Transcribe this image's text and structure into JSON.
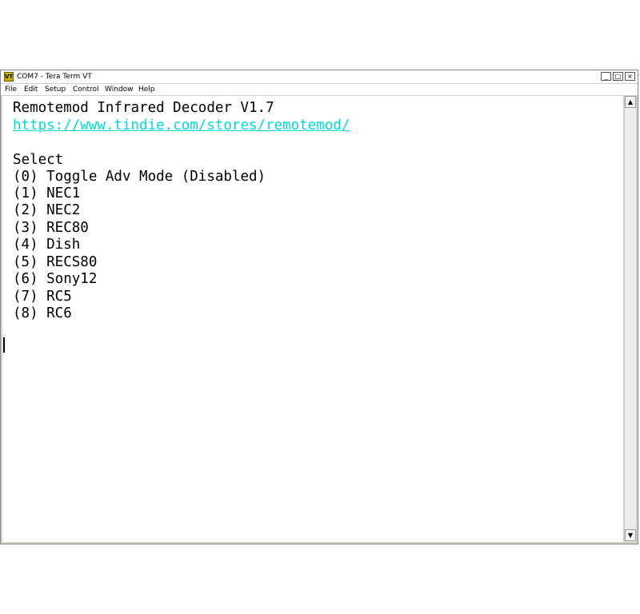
{
  "window": {
    "title": "COM7 - Tera Term VT",
    "icon": "VT",
    "controls": {
      "minimize": "_",
      "maximize": "□",
      "close": "×"
    }
  },
  "menu": {
    "items": [
      "File",
      "Edit",
      "Setup",
      "Control",
      "Window",
      "Help"
    ]
  },
  "terminal": {
    "lines": [
      {
        "text": "Remotemod Infrared Decoder V1.7",
        "style": "normal"
      },
      {
        "text": "https://www.tindie.com/stores/remotemod/",
        "style": "link"
      },
      {
        "text": "",
        "style": "normal"
      },
      {
        "text": "Select",
        "style": "normal"
      },
      {
        "text": "(0) Toggle Adv Mode (Disabled)",
        "style": "normal"
      },
      {
        "text": "(1) NEC1",
        "style": "normal"
      },
      {
        "text": "(2) NEC2",
        "style": "normal"
      },
      {
        "text": "(3) REC80",
        "style": "normal"
      },
      {
        "text": "(4) Dish",
        "style": "normal"
      },
      {
        "text": "(5) RECS80",
        "style": "normal"
      },
      {
        "text": "(6) Sony12",
        "style": "normal"
      },
      {
        "text": "(7) RC5",
        "style": "normal"
      },
      {
        "text": "(8) RC6",
        "style": "normal"
      }
    ],
    "link_color": "#00d8d8"
  },
  "scrollbar": {
    "up": "▲",
    "down": "▼"
  }
}
